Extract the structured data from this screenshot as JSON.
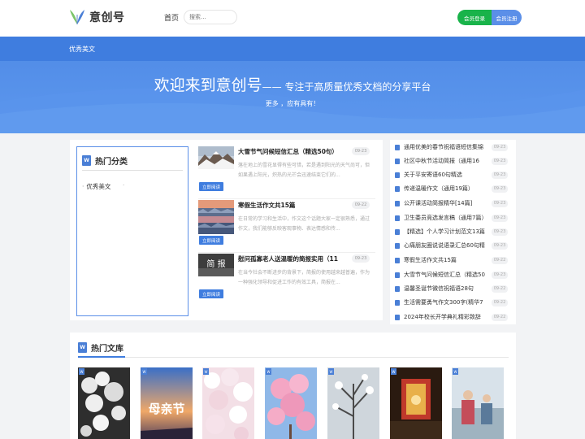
{
  "header": {
    "logo_text": "意创号",
    "nav_home": "首页",
    "search_placeholder": "搜索...",
    "login_label": "会员登录",
    "register_label": "会员注册"
  },
  "banner": {
    "breadcrumb": "优秀美文",
    "title_main": "欢迎来到意创号",
    "title_sub": "—— 专注于高质量优秀文档的分享平台",
    "slogan": "更多 ，应有具有！"
  },
  "categories": {
    "title": "热门分类",
    "items": [
      "优秀美文"
    ],
    "dot": "·"
  },
  "articles": [
    {
      "title": "大雪节气问候短信汇总（精选50句）",
      "date": "09-23",
      "desc": "落在地上的雪花显得有些可惜，若是遇到阳光的天气尚可，但如果遇上阳光，炽热的光芒会迅速结束它们的...",
      "button": "立即阅读"
    },
    {
      "title": "寒假生活作文共15篇",
      "date": "09-22",
      "desc": "在日常的学习和生活中，作文这个话题大家一定很熟悉，通过作文，我们能够反映客观事物、表达情感和传...",
      "button": "立即阅读"
    },
    {
      "title": "慰问孤寡老人送温暖的简报实用（11",
      "date": "09-23",
      "desc": "在当今社会不断进步的背景下，简报的使用越来越普遍，作为一种强化领导和促进工作的有效工具，简报在...",
      "button": "立即阅读",
      "thumb_text": "简 报"
    }
  ],
  "hot_list": [
    {
      "text": "通用优美的春节祝福语短信集锦",
      "date": "09-23"
    },
    {
      "text": "社区中秋节活动简报（通用16",
      "date": "09-23"
    },
    {
      "text": "关于平安寄语60句精选",
      "date": "09-23"
    },
    {
      "text": "传递温暖作文（通用19篇）",
      "date": "09-23"
    },
    {
      "text": "公开课活动简报精华[14篇]",
      "date": "09-23"
    },
    {
      "text": "卫生委员竞选发言稿（通用7篇）",
      "date": "09-23"
    },
    {
      "text": "【精选】个人学习计划范文13篇",
      "date": "09-23"
    },
    {
      "text": "心痛朋友圈说说语录汇总60句精",
      "date": "09-23"
    },
    {
      "text": "寒假生活作文共15篇",
      "date": "09-22"
    },
    {
      "text": "大雪节气问候短信汇总（精选50",
      "date": "09-23"
    },
    {
      "text": "温馨圣诞节微信祝福语28句",
      "date": "09-22"
    },
    {
      "text": "生活需要勇气作文300字(精华7",
      "date": "09-22"
    },
    {
      "text": "2024年校长开学典礼精彩致辞",
      "date": "09-22"
    }
  ],
  "library": {
    "title": "热门文库",
    "badge": "W",
    "card_text": "母亲节"
  },
  "icons": {
    "doc": "W"
  },
  "colors": {
    "primary": "#3f7ddf",
    "login": "#19b34a",
    "register": "#5b8fe8"
  }
}
